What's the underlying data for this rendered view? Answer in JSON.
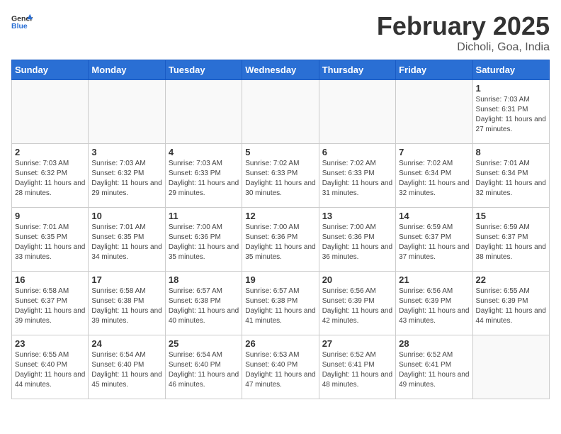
{
  "header": {
    "logo_general": "General",
    "logo_blue": "Blue",
    "month": "February 2025",
    "location": "Dicholi, Goa, India"
  },
  "days_of_week": [
    "Sunday",
    "Monday",
    "Tuesday",
    "Wednesday",
    "Thursday",
    "Friday",
    "Saturday"
  ],
  "weeks": [
    [
      {
        "day": "",
        "info": ""
      },
      {
        "day": "",
        "info": ""
      },
      {
        "day": "",
        "info": ""
      },
      {
        "day": "",
        "info": ""
      },
      {
        "day": "",
        "info": ""
      },
      {
        "day": "",
        "info": ""
      },
      {
        "day": "1",
        "info": "Sunrise: 7:03 AM\nSunset: 6:31 PM\nDaylight: 11 hours and 27 minutes."
      }
    ],
    [
      {
        "day": "2",
        "info": "Sunrise: 7:03 AM\nSunset: 6:32 PM\nDaylight: 11 hours and 28 minutes."
      },
      {
        "day": "3",
        "info": "Sunrise: 7:03 AM\nSunset: 6:32 PM\nDaylight: 11 hours and 29 minutes."
      },
      {
        "day": "4",
        "info": "Sunrise: 7:03 AM\nSunset: 6:33 PM\nDaylight: 11 hours and 29 minutes."
      },
      {
        "day": "5",
        "info": "Sunrise: 7:02 AM\nSunset: 6:33 PM\nDaylight: 11 hours and 30 minutes."
      },
      {
        "day": "6",
        "info": "Sunrise: 7:02 AM\nSunset: 6:33 PM\nDaylight: 11 hours and 31 minutes."
      },
      {
        "day": "7",
        "info": "Sunrise: 7:02 AM\nSunset: 6:34 PM\nDaylight: 11 hours and 32 minutes."
      },
      {
        "day": "8",
        "info": "Sunrise: 7:01 AM\nSunset: 6:34 PM\nDaylight: 11 hours and 32 minutes."
      }
    ],
    [
      {
        "day": "9",
        "info": "Sunrise: 7:01 AM\nSunset: 6:35 PM\nDaylight: 11 hours and 33 minutes."
      },
      {
        "day": "10",
        "info": "Sunrise: 7:01 AM\nSunset: 6:35 PM\nDaylight: 11 hours and 34 minutes."
      },
      {
        "day": "11",
        "info": "Sunrise: 7:00 AM\nSunset: 6:36 PM\nDaylight: 11 hours and 35 minutes."
      },
      {
        "day": "12",
        "info": "Sunrise: 7:00 AM\nSunset: 6:36 PM\nDaylight: 11 hours and 35 minutes."
      },
      {
        "day": "13",
        "info": "Sunrise: 7:00 AM\nSunset: 6:36 PM\nDaylight: 11 hours and 36 minutes."
      },
      {
        "day": "14",
        "info": "Sunrise: 6:59 AM\nSunset: 6:37 PM\nDaylight: 11 hours and 37 minutes."
      },
      {
        "day": "15",
        "info": "Sunrise: 6:59 AM\nSunset: 6:37 PM\nDaylight: 11 hours and 38 minutes."
      }
    ],
    [
      {
        "day": "16",
        "info": "Sunrise: 6:58 AM\nSunset: 6:37 PM\nDaylight: 11 hours and 39 minutes."
      },
      {
        "day": "17",
        "info": "Sunrise: 6:58 AM\nSunset: 6:38 PM\nDaylight: 11 hours and 39 minutes."
      },
      {
        "day": "18",
        "info": "Sunrise: 6:57 AM\nSunset: 6:38 PM\nDaylight: 11 hours and 40 minutes."
      },
      {
        "day": "19",
        "info": "Sunrise: 6:57 AM\nSunset: 6:38 PM\nDaylight: 11 hours and 41 minutes."
      },
      {
        "day": "20",
        "info": "Sunrise: 6:56 AM\nSunset: 6:39 PM\nDaylight: 11 hours and 42 minutes."
      },
      {
        "day": "21",
        "info": "Sunrise: 6:56 AM\nSunset: 6:39 PM\nDaylight: 11 hours and 43 minutes."
      },
      {
        "day": "22",
        "info": "Sunrise: 6:55 AM\nSunset: 6:39 PM\nDaylight: 11 hours and 44 minutes."
      }
    ],
    [
      {
        "day": "23",
        "info": "Sunrise: 6:55 AM\nSunset: 6:40 PM\nDaylight: 11 hours and 44 minutes."
      },
      {
        "day": "24",
        "info": "Sunrise: 6:54 AM\nSunset: 6:40 PM\nDaylight: 11 hours and 45 minutes."
      },
      {
        "day": "25",
        "info": "Sunrise: 6:54 AM\nSunset: 6:40 PM\nDaylight: 11 hours and 46 minutes."
      },
      {
        "day": "26",
        "info": "Sunrise: 6:53 AM\nSunset: 6:40 PM\nDaylight: 11 hours and 47 minutes."
      },
      {
        "day": "27",
        "info": "Sunrise: 6:52 AM\nSunset: 6:41 PM\nDaylight: 11 hours and 48 minutes."
      },
      {
        "day": "28",
        "info": "Sunrise: 6:52 AM\nSunset: 6:41 PM\nDaylight: 11 hours and 49 minutes."
      },
      {
        "day": "",
        "info": ""
      }
    ]
  ]
}
